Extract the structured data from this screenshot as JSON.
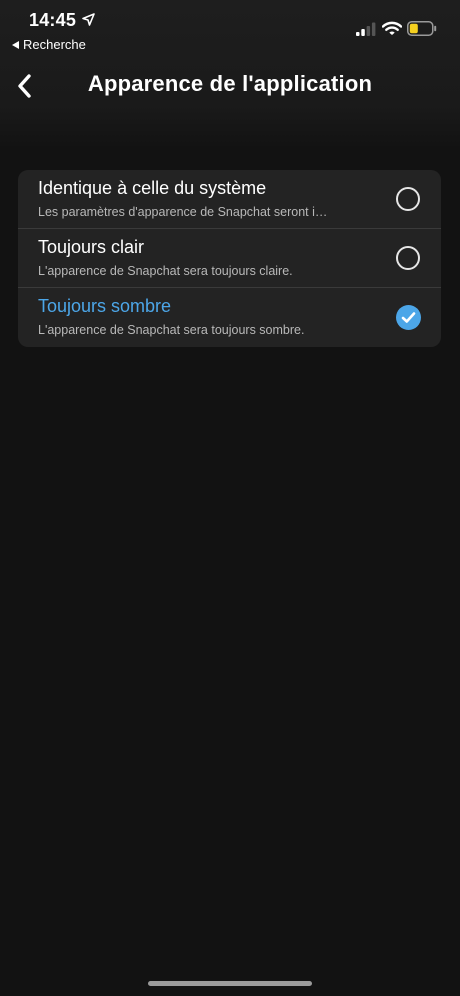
{
  "status_bar": {
    "time": "14:45",
    "back_app_label": "Recherche",
    "battery_color": "#f5d020"
  },
  "nav": {
    "title": "Apparence de l'application"
  },
  "options": [
    {
      "title": "Identique à celle du système",
      "subtitle": "Les paramètres d'apparence de Snapchat seront i…",
      "selected": false
    },
    {
      "title": "Toujours clair",
      "subtitle": "L'apparence de Snapchat sera toujours claire.",
      "selected": false
    },
    {
      "title": "Toujours sombre",
      "subtitle": "L'apparence de Snapchat sera toujours sombre.",
      "selected": true
    }
  ],
  "colors": {
    "accent": "#4ca6e8",
    "background": "#121212",
    "card": "#232323"
  },
  "icons": {
    "back": "chevron-left-icon",
    "selected": "checkmark-icon",
    "location": "location-arrow-icon"
  }
}
